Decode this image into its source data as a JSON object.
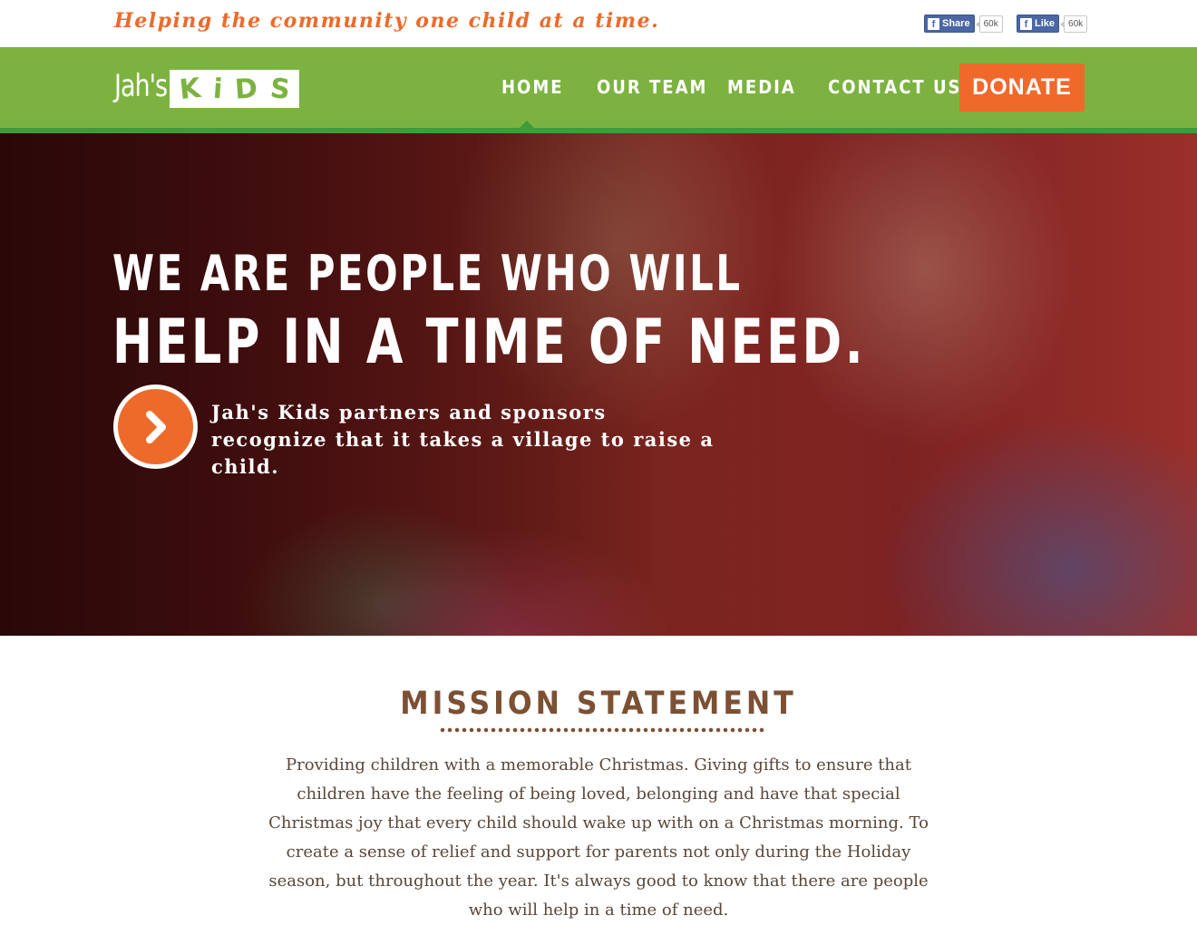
{
  "topbar": {
    "tagline": "Helping the community one child at a time.",
    "share": {
      "label": "Share",
      "count": "60k",
      "icon": "facebook-icon"
    },
    "like": {
      "label": "Like",
      "count": "60k",
      "icon": "facebook-icon"
    }
  },
  "logo": {
    "prefix": "Jah's",
    "letters": [
      "K",
      "i",
      "D",
      "S"
    ]
  },
  "nav": {
    "items": [
      {
        "label": "HOME",
        "active": true
      },
      {
        "label": "OUR TEAM"
      },
      {
        "label": "MEDIA"
      },
      {
        "label": "CONTACT US"
      }
    ],
    "donate_label": "DONATE"
  },
  "hero": {
    "line1": "WE ARE PEOPLE WHO WILL",
    "line2": "HELP IN A TIME OF NEED.",
    "sub": "Jah's Kids partners and sponsors recognize that it takes a village to raise a child.",
    "arrow_icon": "chevron-right-icon"
  },
  "mission": {
    "title": "MISSION STATEMENT",
    "body": "Providing children with a memorable Christmas. Giving gifts to ensure that children have the feeling of being loved, belonging and have that special Christmas joy that every child should wake up with on a Christmas morning. To create a sense of relief and support for parents not only during the Holiday season, but throughout the year. It's always good to know that there are people who will help in a time of need."
  },
  "colors": {
    "orange": "#ee6a2a",
    "green": "#7cb340",
    "dark_green": "#3f9b3c",
    "brown": "#7c5033",
    "facebook_blue": "#4a66a5"
  }
}
